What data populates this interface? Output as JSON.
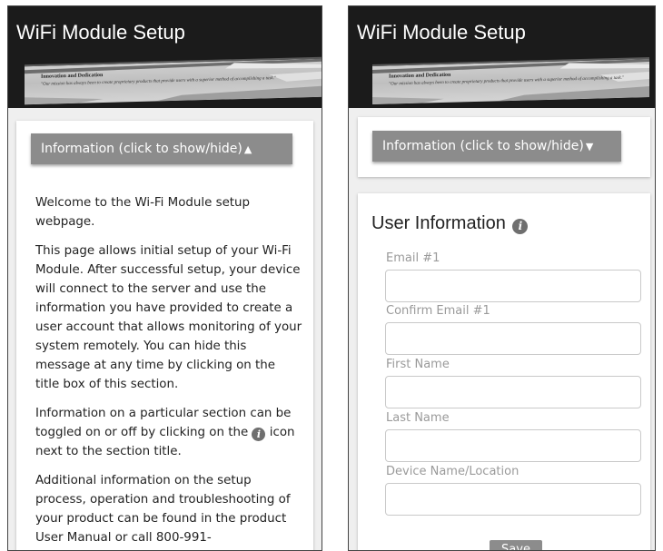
{
  "app": {
    "title": "WiFi Module Setup"
  },
  "banner": {
    "heading": "Innovation and Dedication",
    "tagline": "\"Our mission has always been to create proprietary products that provide users with a superior method of accomplishing a task.\""
  },
  "info_section": {
    "toggle_label": "Information (click to show/hide)",
    "expanded_arrow": "▲",
    "collapsed_arrow": "▼",
    "icon": "info-icon",
    "paragraphs": {
      "p1": "Welcome to the Wi-Fi Module setup webpage.",
      "p2": "This page allows initial setup of your Wi-Fi Module. After successful setup, your device will connect to the server and use the information you have provided to create a user account that allows monitoring of your system remotely. You can hide this message at any time by clicking on the title box of this section.",
      "p3_before": "Information on a particular section can be toggled on or off by clicking on the",
      "p3_after": "icon next to the section title.",
      "p4": "Additional information on the setup process, operation and troubleshooting of your product can be found in the product User Manual or call 800-991-"
    }
  },
  "user_info": {
    "title": "User Information",
    "icon": "info-icon",
    "fields": [
      {
        "label": "Email #1",
        "value": ""
      },
      {
        "label": "Confirm Email #1",
        "value": ""
      },
      {
        "label": "First Name",
        "value": ""
      },
      {
        "label": "Last Name",
        "value": ""
      },
      {
        "label": "Device Name/Location",
        "value": ""
      }
    ],
    "save_label": "Save"
  },
  "colors": {
    "header_bg": "#1b1b1b",
    "toggle_bg": "#8c8c8c",
    "page_bg": "#efefef"
  }
}
